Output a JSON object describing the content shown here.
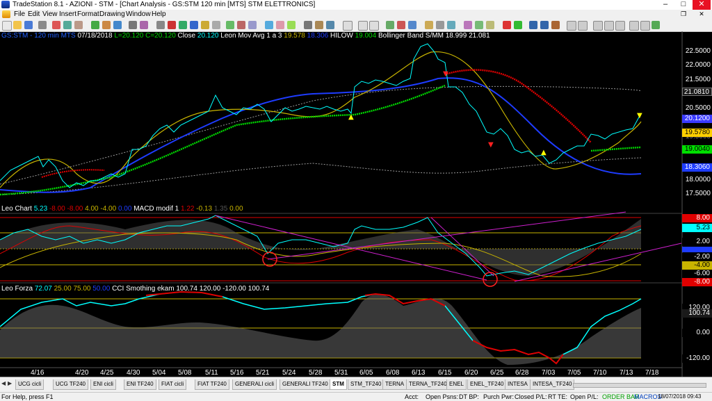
{
  "window": {
    "title": "TradeStation 8.1 - AZIONI - STM - [Chart Analysis - GS:STM  120 min  [MTS] STM ELETTRONICS]",
    "min": "–",
    "max": "□",
    "close": "✕"
  },
  "menu": [
    "File",
    "Edit",
    "View",
    "Insert",
    "Format",
    "Drawing",
    "Window",
    "Help"
  ],
  "panes": {
    "price": {
      "h1": "GS:STM - 120 min",
      "h2": "MTS",
      "h3": "07/18/2018",
      "h4": "L=20.120",
      "h5": "C=20.120",
      "h6": "Close",
      "h7": "20.120",
      "h8": "Leon Mov Avg 1 a 3",
      "h9": "19.578",
      "h10": "18.306",
      "h11": "HILOW",
      "h12": "19.004",
      "h13": "Bollinger Band S/MM",
      "h14": "18.999",
      "h15": "21.081",
      "ticks": [
        "22.5000",
        "22.0000",
        "21.5000",
        "21.0000",
        "20.5000",
        "20.0000",
        "19.5000",
        "19.0000",
        "18.5000",
        "18.0000",
        "17.5000"
      ],
      "labels": [
        "21.0810",
        "20.1200",
        "19.5780",
        "19.0040",
        "18.3060"
      ]
    },
    "macd": {
      "h1": "Leo Chart",
      "h2": "5.23",
      "h3": "-8.00",
      "h4": "-8.00",
      "h5": "4.00",
      "h6": "-4.00",
      "h7": "0.00",
      "h8": "MACD modif 1",
      "h9": "1.22",
      "h10": "-0.13",
      "h11": "1.35",
      "h12": "0.00",
      "ticks": [
        "8.00",
        "5.23",
        "2.00",
        "-2.00",
        "-4.00",
        "-6.00",
        "-8.00"
      ]
    },
    "cci": {
      "h1": "Leo Forza",
      "h2": "72.07",
      "h3": "25.00",
      "h4": "75.00",
      "h5": "50.00",
      "h6": "CCI Smothing ekam",
      "h7": "100.74",
      "h8": "120.00",
      "h9": "-120.00",
      "h10": "100.74",
      "ticks": [
        "120.00",
        "100.74",
        "0.00",
        "-120.00"
      ]
    }
  },
  "xaxis": [
    "4/16",
    "4/20",
    "4/25",
    "4/30",
    "5/04",
    "5/08",
    "5/11",
    "5/16",
    "5/21",
    "5/24",
    "5/28",
    "5/31",
    "6/05",
    "6/08",
    "6/13",
    "6/15",
    "6/20",
    "6/25",
    "6/28",
    "7/03",
    "7/05",
    "7/10",
    "7/13",
    "7/18"
  ],
  "tabs": [
    "UCG cicli",
    "UCG TF240",
    "ENI cicli",
    "ENI TF240",
    "FIAT cicli",
    "FIAT TF240",
    "GENERALI cicli",
    "GENERALI TF240",
    "STM",
    "STM_TF240",
    "TERNA",
    "TERNA_TF240",
    "ENEL",
    "ENEL_TF240",
    "INTESA",
    "INTESA_TF240"
  ],
  "status": {
    "help": "For Help, press F1",
    "acct": "Acct:",
    "open_psns": "Open Psns:",
    "dt_bp": "DT BP:",
    "purch_pwr": "Purch Pwr:",
    "closed_pl": "Closed P/L:",
    "rt_te": "RT TE:",
    "open_pl": "Open P/L:",
    "order_bar": "ORDER BAR",
    "macros": "MACROS",
    "datetime": "18/07/2018 09:43"
  },
  "colors": {
    "price": "#00ffff",
    "ma_fast": "#c8b400",
    "ma_slow": "#1e3cff",
    "hilow_up": "#00d800",
    "hilow_dn": "#e00000",
    "band": "#9a9a9a"
  }
}
